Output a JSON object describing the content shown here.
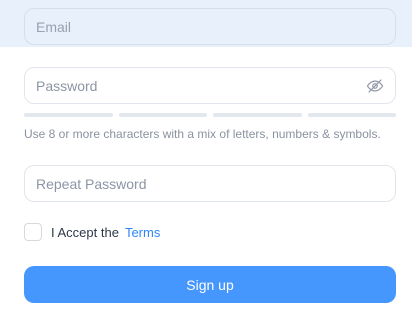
{
  "form": {
    "email": {
      "placeholder": "Email",
      "value": ""
    },
    "password": {
      "placeholder": "Password",
      "value": "",
      "toggle_icon": "eye-off-icon"
    },
    "strength_meter": {
      "segments": 4,
      "filled": 0
    },
    "hint": "Use 8 or more characters with a mix of letters, numbers & symbols.",
    "repeat_password": {
      "placeholder": "Repeat Password",
      "value": ""
    },
    "terms": {
      "checked": false,
      "text": "I Accept the",
      "link": "Terms"
    },
    "submit_label": "Sign up"
  },
  "colors": {
    "accent": "#4596fd",
    "link": "#2f86f5",
    "highlight_band": "#e8f0fc"
  }
}
